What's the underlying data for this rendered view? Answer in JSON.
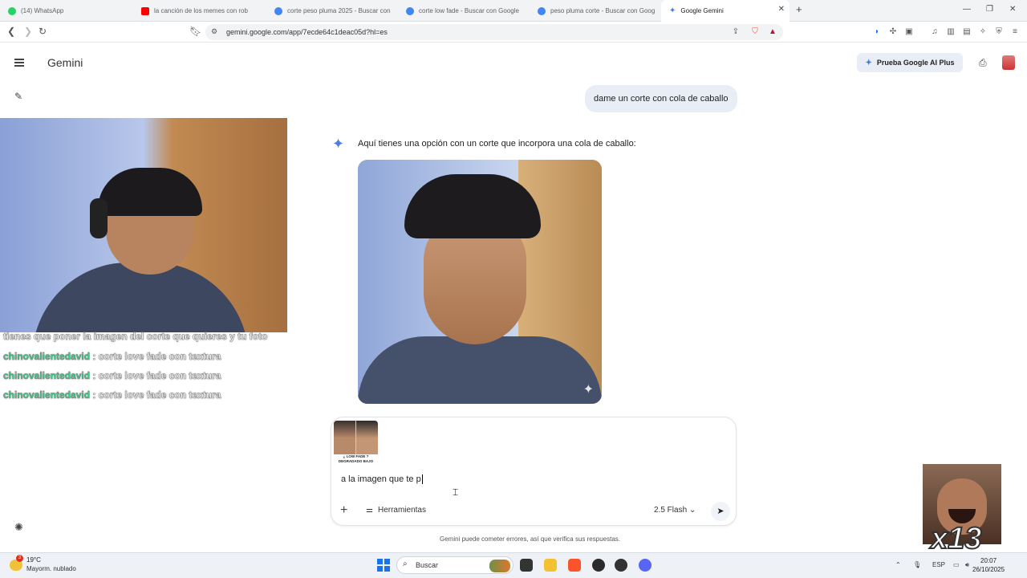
{
  "browser": {
    "tabs": [
      {
        "label": "(14) WhatsApp",
        "color": "#25d366"
      },
      {
        "label": "la canción de los memes con rob",
        "color": "#ff0000"
      },
      {
        "label": "corte peso pluma 2025 - Buscar con",
        "color": "#4285f4"
      },
      {
        "label": "corte low fade - Buscar con Google",
        "color": "#4285f4"
      },
      {
        "label": "peso pluma corte - Buscar con Goog",
        "color": "#4285f4"
      },
      {
        "label": "Google Gemini",
        "color": "#4a7de8"
      }
    ],
    "url": "gemini.google.com/app/7ecde64c1deac05d?hl=es"
  },
  "gemini": {
    "app_title": "Gemini",
    "upgrade_label": "Prueba Google AI Plus",
    "user_message": "dame un corte con cola de caballo",
    "reply": "Aquí tienes una opción con un corte que incorpora una cola de caballo:",
    "thumb_caption_1": "¿ LOW FADE ?",
    "thumb_caption_2": "DEGRADADO BAJO",
    "compose_text": "a la imagen que te p",
    "tools_label": "Herramientas",
    "model_label": "2.5 Flash",
    "disclaimer": "Gemini puede cometer errores, así que verifica sus respuestas.",
    "accent": "#4a7de8"
  },
  "overlay": {
    "chat": [
      {
        "user": "",
        "text": "tienes que poner la imagen del corte que quieres y tu foto"
      },
      {
        "user": "chinovalientedavid",
        "text": ": corte love fade con textura"
      },
      {
        "user": "chinovalientedavid",
        "text": ": corte love fade con textura"
      },
      {
        "user": "chinovalientedavid",
        "text": ": corte love fade con textura"
      }
    ],
    "meme_text": "x13"
  },
  "taskbar": {
    "weather_temp": "19°C",
    "weather_desc": "Mayorm. nublado",
    "weather_badge": "3",
    "search_label": "Buscar",
    "lang": "ESP",
    "time": "20:07",
    "date": "26/10/2025"
  }
}
